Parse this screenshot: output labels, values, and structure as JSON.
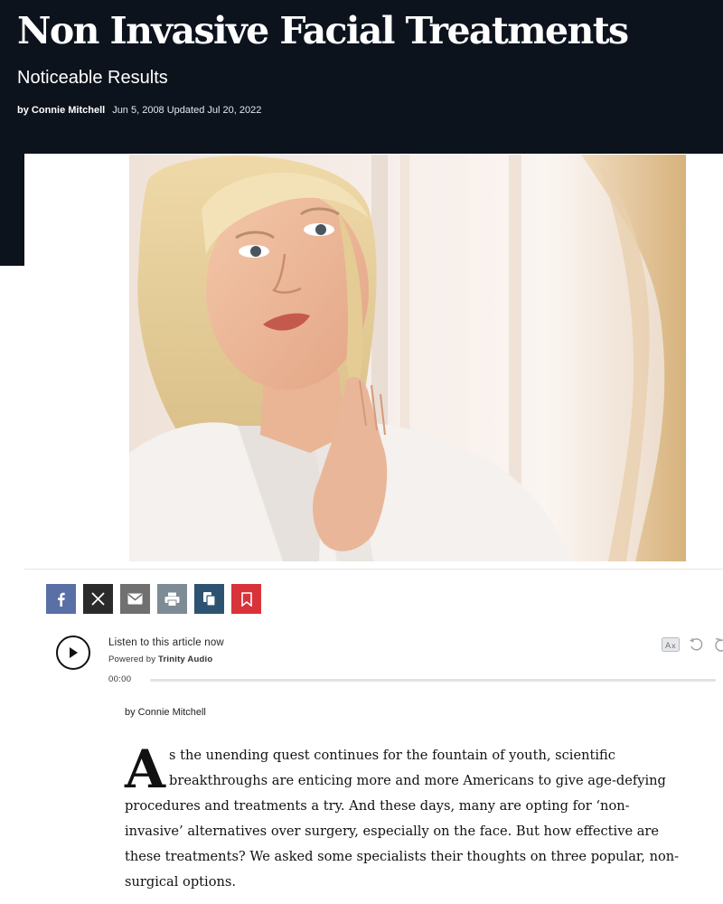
{
  "article": {
    "title": "Non Invasive Facial Treatments",
    "subtitle": "Noticeable Results",
    "byline_prefix": "by ",
    "author": "Connie Mitchell",
    "date": "Jun 5, 2008 Updated Jul 20, 2022",
    "body_byline": "by Connie Mitchell",
    "dropcap": "A",
    "body_text": "s the unending quest continues for the fountain of youth, scientific breakthroughs are enticing more and more Americans to give age-defying procedures and treatments a try. And these days, many are opting for ‘non-invasive’ alternatives over surgery, especially on the face. But how effective are these treatments? We asked some specialists their thoughts on three popular, non-surgical options."
  },
  "share_buttons": [
    {
      "icon": "facebook-icon",
      "color": "#5a6fa6"
    },
    {
      "icon": "x-icon",
      "color": "#2b2b2b"
    },
    {
      "icon": "email-icon",
      "color": "#707070"
    },
    {
      "icon": "print-icon",
      "color": "#7d8b94"
    },
    {
      "icon": "copy-icon",
      "color": "#2e5372"
    },
    {
      "icon": "bookmark-icon",
      "color": "#d9333a"
    }
  ],
  "audio_player": {
    "listen_label": "Listen to this article now",
    "powered_prefix": "Powered by ",
    "powered_brand": "Trinity Audio",
    "current_time": "00:00",
    "progress": 0
  },
  "colors": {
    "header_bg": "#0d131d",
    "header_text": "#ffffff"
  }
}
